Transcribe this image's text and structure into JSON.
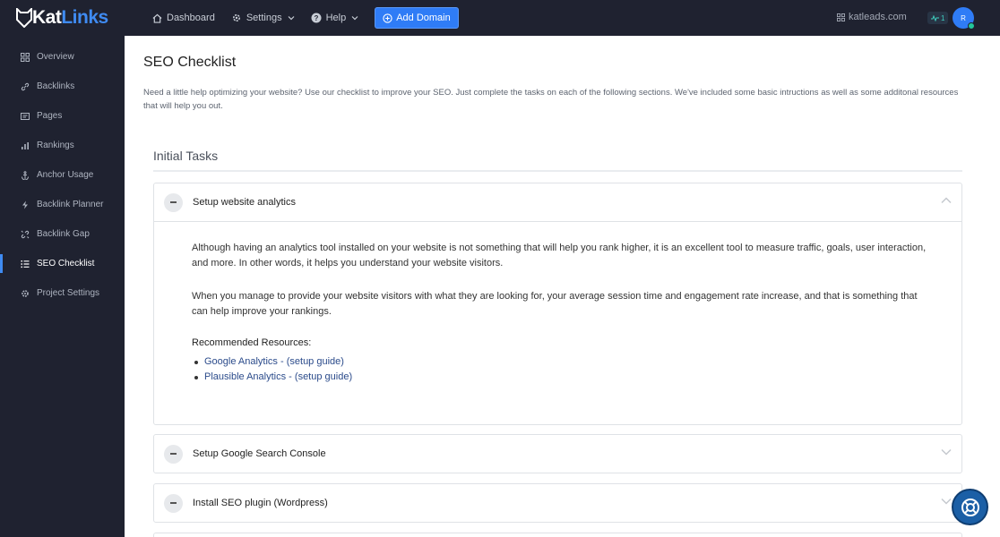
{
  "brand": {
    "kat": "Kat",
    "links": "Links"
  },
  "nav": {
    "dashboard": "Dashboard",
    "settings": "Settings",
    "help": "Help",
    "add_domain": "Add Domain"
  },
  "header": {
    "site": "katleads.com",
    "activity_count": "1",
    "avatar_initial": "R"
  },
  "sidebar": {
    "items": [
      {
        "label": "Overview",
        "icon": "grid-icon"
      },
      {
        "label": "Backlinks",
        "icon": "link-icon"
      },
      {
        "label": "Pages",
        "icon": "page-icon"
      },
      {
        "label": "Rankings",
        "icon": "bar-chart-icon"
      },
      {
        "label": "Anchor Usage",
        "icon": "anchor-icon"
      },
      {
        "label": "Backlink Planner",
        "icon": "bolt-icon"
      },
      {
        "label": "Backlink Gap",
        "icon": "gap-icon"
      },
      {
        "label": "SEO Checklist",
        "icon": "list-icon",
        "active": true
      },
      {
        "label": "Project Settings",
        "icon": "gear-icon"
      }
    ]
  },
  "main": {
    "title": "SEO Checklist",
    "intro": "Need a little help optimizing your website? Use our checklist to improve your SEO. Just complete the tasks on each of the following sections. We've included some basic intructions as well as some additonal resources that will help you out.",
    "section_title": "Initial Tasks",
    "tasks": [
      {
        "title": "Setup website analytics",
        "expanded": true,
        "paragraphs": [
          "Although having an analytics tool installed on your website is not something that will help you rank higher, it is an excellent tool to measure traffic, goals, user interaction, and more. In other words, it helps you understand your website visitors.",
          "When you manage to provide your website visitors with what they are looking for, your average session time and engagement rate increase, and that is something that can help improve your rankings."
        ],
        "resources_title": "Recommended Resources:",
        "resources": [
          {
            "name": "Google Analytics",
            "guide": "setup guide"
          },
          {
            "name": "Plausible Analytics",
            "guide": "setup guide"
          }
        ]
      },
      {
        "title": "Setup Google Search Console",
        "expanded": false
      },
      {
        "title": "Install SEO plugin (Wordpress)",
        "expanded": false
      }
    ]
  },
  "colors": {
    "nav_bg": "#1f2230",
    "accent": "#2f7cf6",
    "link": "#2b4b8b",
    "status_online": "#23c79a"
  }
}
